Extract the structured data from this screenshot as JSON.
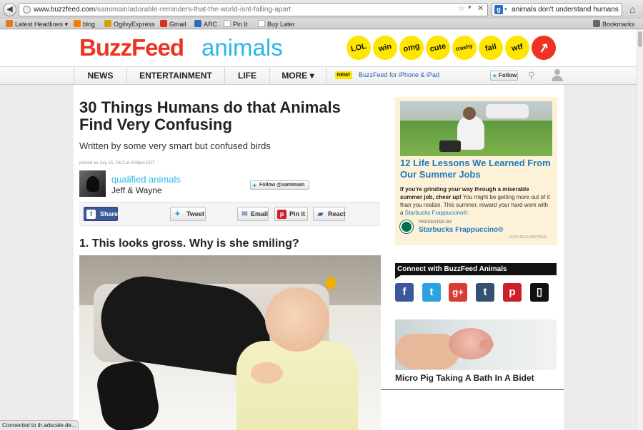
{
  "browser": {
    "url_host": "www.buzzfeed.com",
    "url_path": "/samimain/adorable-reminders-that-the-world-isnt-falling-apart",
    "search_engine_icon": "google-icon",
    "search_query": "animals don't understand humans",
    "bookmarks": [
      {
        "label": "Latest Headlines",
        "icon": "rss-icon",
        "color": "#e07b1f",
        "dropdown": "▾"
      },
      {
        "label": "blog",
        "icon": "blogger-icon",
        "color": "#f57d00"
      },
      {
        "label": "OgilvyExpress",
        "icon": "star-icon",
        "color": "#d4a300"
      },
      {
        "label": "Gmail",
        "icon": "gmail-icon",
        "color": "#d93025"
      },
      {
        "label": "ARC",
        "icon": "wifi-icon",
        "color": "#2a6ebb"
      },
      {
        "label": "Pin It",
        "icon": "page-icon",
        "color": "#bbbbbb"
      },
      {
        "label": "Buy Later",
        "icon": "page-icon",
        "color": "#bbbbbb"
      }
    ],
    "bookmarks_menu": "Bookmarks",
    "status_text": "Connected to ih.adscale.de..."
  },
  "header": {
    "logo_primary": "BuzzFeed",
    "logo_section": "animals",
    "badges": [
      "LOL",
      "win",
      "omg",
      "cute",
      "trashy",
      "fail",
      "wtf"
    ],
    "trending_icon": "↗"
  },
  "nav": {
    "items": [
      "NEWS",
      "ENTERTAINMENT",
      "LIFE",
      "MORE"
    ],
    "more_chevron": "▾",
    "new_badge": "NEW!",
    "promo": "BuzzFeed for iPhone & iPad",
    "follow_label": "Follow"
  },
  "article": {
    "title": "30 Things Humans do that Animals Find Very Confusing",
    "subtitle": "Written by some very smart but confused birds",
    "posted": "posted on July 15, 2013 at 4:56pm EDT",
    "author_name": "qualified animals",
    "author_sub": "Jeff & Wayne",
    "follow_author": "Follow @samimain",
    "share": {
      "facebook": "Share",
      "twitter": "Tweet",
      "email": "Email",
      "pinterest": "Pin it",
      "react": "React"
    },
    "item_1_title": "1. This looks gross. Why is she smiling?"
  },
  "sidebar": {
    "ad": {
      "title": "12 Life Lessons We Learned From Our Summer Jobs",
      "body_bold": "If you're grinding your way through a miserable summer job, cheer up!",
      "body_rest": " You might be getting more out of it than you realize. This summer, reward your hard work with a ",
      "body_link": "Starbucks Frappuccino®.",
      "presented_by": "PRESENTED BY",
      "brand": "Starbucks Frappuccino®",
      "featured": "FEATURED PARTNER"
    },
    "connect_title": "Connect with BuzzFeed Animals",
    "social": [
      {
        "icon": "facebook-icon",
        "glyph": "f",
        "color": "#3b5998"
      },
      {
        "icon": "twitter-icon",
        "glyph": "t",
        "color": "#2aa3e0"
      },
      {
        "icon": "google-plus-icon",
        "glyph": "g+",
        "color": "#d73d32"
      },
      {
        "icon": "tumblr-icon",
        "glyph": "t",
        "color": "#34526f"
      },
      {
        "icon": "pinterest-icon",
        "glyph": "p",
        "color": "#cb2027"
      },
      {
        "icon": "mobile-icon",
        "glyph": "▯",
        "color": "#111111"
      }
    ],
    "story_title": "Micro Pig Taking A Bath In A Bidet"
  },
  "colors": {
    "buzzfeed_red": "#ee3322",
    "animals_blue": "#2ab7e8",
    "badge_yellow": "#ffe600",
    "link_blue": "#1d7bc1"
  }
}
